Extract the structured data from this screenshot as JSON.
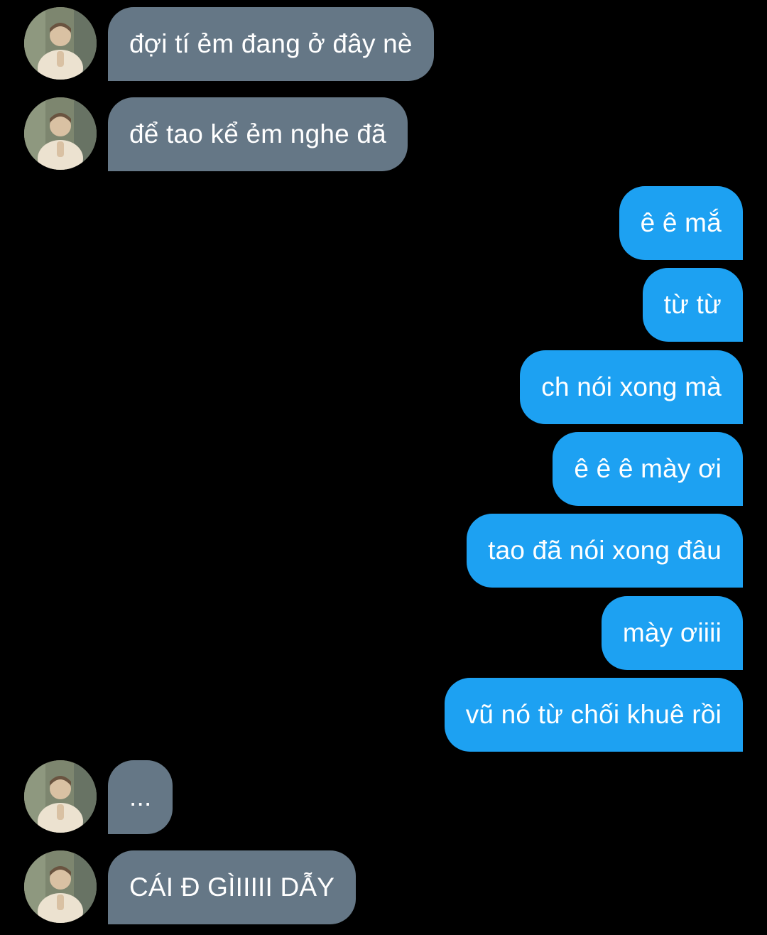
{
  "conversation": {
    "messages": [
      {
        "direction": "incoming",
        "text": "đợi tí ẻm đang ở đây nè",
        "avatar": "contact-avatar"
      },
      {
        "direction": "incoming",
        "text": "để tao kể ẻm nghe đã",
        "avatar": "contact-avatar"
      },
      {
        "direction": "outgoing",
        "text": "ê ê mắ"
      },
      {
        "direction": "outgoing",
        "text": "từ từ"
      },
      {
        "direction": "outgoing",
        "text": "ch nói xong mà"
      },
      {
        "direction": "outgoing",
        "text": "ê ê ê mày ơi"
      },
      {
        "direction": "outgoing",
        "text": "tao đã nói xong đâu"
      },
      {
        "direction": "outgoing",
        "text": "mày ơiiii"
      },
      {
        "direction": "outgoing",
        "text": "vũ nó từ chối khuê rồi"
      },
      {
        "direction": "incoming",
        "text": "...",
        "avatar": "contact-avatar"
      },
      {
        "direction": "incoming",
        "text": "CÁI Đ GÌIIIII DẪY",
        "avatar": "contact-avatar"
      }
    ]
  },
  "colors": {
    "background": "#000000",
    "incoming_bubble": "#657786",
    "outgoing_bubble": "#1da1f2",
    "text": "#ffffff"
  }
}
